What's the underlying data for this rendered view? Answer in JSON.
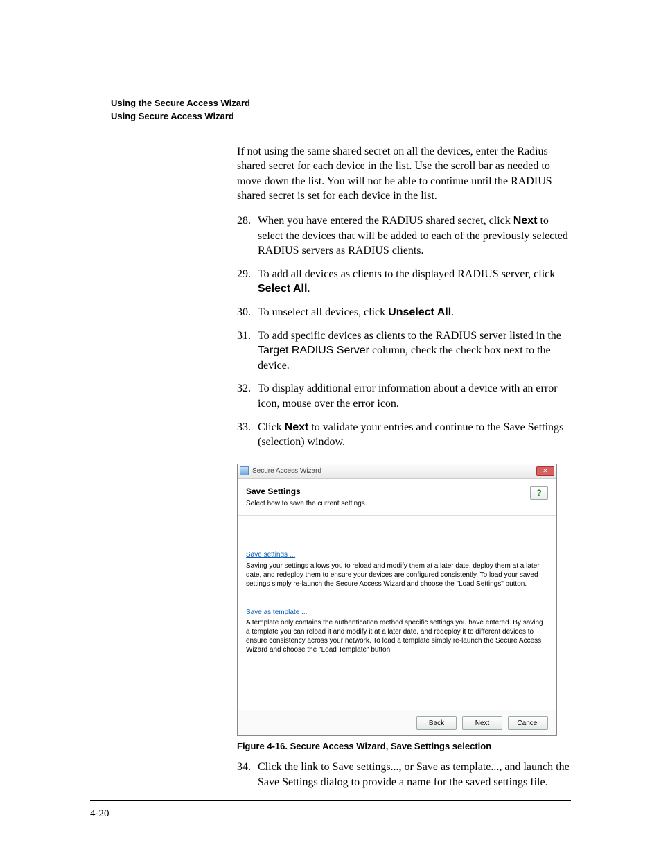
{
  "header": {
    "line1": "Using the Secure Access Wizard",
    "line2": "Using Secure Access Wizard"
  },
  "intro": "If not using the same shared secret on all the devices, enter the Radius shared secret for each device in the list. Use the scroll bar as needed to move down the list. You will not be able to continue until the RADIUS shared secret is set for each device in the list.",
  "steps": {
    "s28": {
      "num": "28.",
      "pre": "When you have entered the RADIUS shared secret, click ",
      "bold": "Next",
      "post": " to select the devices that will be added to each of the previously selected RADIUS servers as RADIUS clients."
    },
    "s29": {
      "num": "29.",
      "pre": "To add all devices as clients to the displayed RADIUS server, click ",
      "bold": "Select All",
      "post": "."
    },
    "s30": {
      "num": "30.",
      "pre": "To unselect all devices, click ",
      "bold": "Unselect All",
      "post": "."
    },
    "s31": {
      "num": "31.",
      "pre": "To add specific devices as clients to the RADIUS server listed in the ",
      "sans1": "Target RADIUS Server",
      "post": " column, check the check box next to the device."
    },
    "s32": {
      "num": "32.",
      "text": "To display additional error information about a device with an error icon, mouse over the error icon."
    },
    "s33": {
      "num": "33.",
      "pre": "Click ",
      "bold": "Next",
      "post": " to validate your entries and continue to the Save Settings (selection) window."
    },
    "s34": {
      "num": "34.",
      "text": "Click the link to Save settings..., or Save as template..., and launch the Save Settings dialog to provide a name for the saved settings file."
    }
  },
  "figureCaption": "Figure 4-16. Secure Access Wizard, Save Settings selection",
  "dialog": {
    "windowTitle": "Secure Access Wizard",
    "title": "Save Settings",
    "subtitle": "Select how to save the current settings.",
    "link1": "Save settings ...",
    "desc1": "Saving your settings allows you to reload and modify them at a later date, deploy them at a later date, and redeploy them to ensure your devices are configured consistently. To load your saved settings simply re-launch the Secure Access Wizard and choose the \"Load Settings\" button.",
    "link2": "Save as template ...",
    "desc2": "A template only contains the authentication method specific settings you have entered. By saving a template you can reload it and modify it at a later date, and redeploy it to different devices to ensure consistency across your network. To load a template simply re-launch the Secure Access Wizard and choose the \"Load Template\" button.",
    "back_b": "B",
    "back_rest": "ack",
    "next_n": "N",
    "next_rest": "ext",
    "cancel": "Cancel",
    "help_glyph": "?"
  },
  "pageNumber": "4-20"
}
